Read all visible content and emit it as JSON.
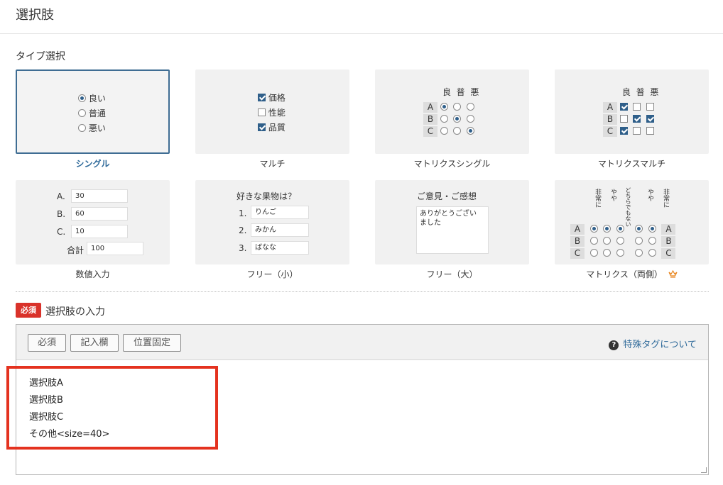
{
  "page": {
    "title": "選択肢"
  },
  "type_section": {
    "label": "タイプ選択"
  },
  "cards": {
    "single": {
      "label": "シングル",
      "options": [
        "良い",
        "普通",
        "悪い"
      ]
    },
    "multi": {
      "label": "マルチ",
      "options": [
        "価格",
        "性能",
        "品質"
      ]
    },
    "matrix_single": {
      "label": "マトリクスシングル",
      "cols": [
        "良",
        "普",
        "悪"
      ],
      "rows": [
        "A",
        "B",
        "C"
      ]
    },
    "matrix_multi": {
      "label": "マトリクスマルチ",
      "cols": [
        "良",
        "普",
        "悪"
      ],
      "rows": [
        "A",
        "B",
        "C"
      ]
    },
    "numeric": {
      "label": "数値入力",
      "rows": [
        {
          "k": "A.",
          "v": "30"
        },
        {
          "k": "B.",
          "v": "60"
        },
        {
          "k": "C.",
          "v": "10"
        }
      ],
      "total_label": "合計",
      "total": "100"
    },
    "free_small": {
      "label": "フリー（小）",
      "question": "好きな果物は？",
      "rows": [
        {
          "k": "1.",
          "v": "りんご"
        },
        {
          "k": "2.",
          "v": "みかん"
        },
        {
          "k": "3.",
          "v": "ばなな"
        }
      ]
    },
    "free_large": {
      "label": "フリー（大）",
      "question": "ご意見・ご感想",
      "text_line1": "ありがとうござい",
      "text_line2": "ました"
    },
    "matrix_both": {
      "label": "マトリクス（両側）",
      "headers": [
        "非常に",
        "やや",
        "どちらでもない",
        "やや",
        "非常に"
      ],
      "rows": [
        "A",
        "B",
        "C"
      ]
    }
  },
  "input_section": {
    "badge": "必須",
    "label": "選択肢の入力"
  },
  "toolbar": {
    "required": "必須",
    "entry": "記入欄",
    "fixed": "位置固定",
    "help": "特殊タグについて"
  },
  "editor": {
    "lines": [
      "選択肢A",
      "選択肢B",
      "選択肢C",
      "その他<size=40>"
    ]
  },
  "colors": {
    "accent": "#2f6a9a",
    "highlight": "#e4321f",
    "badge": "#d9322a",
    "crown": "#e8831a"
  }
}
